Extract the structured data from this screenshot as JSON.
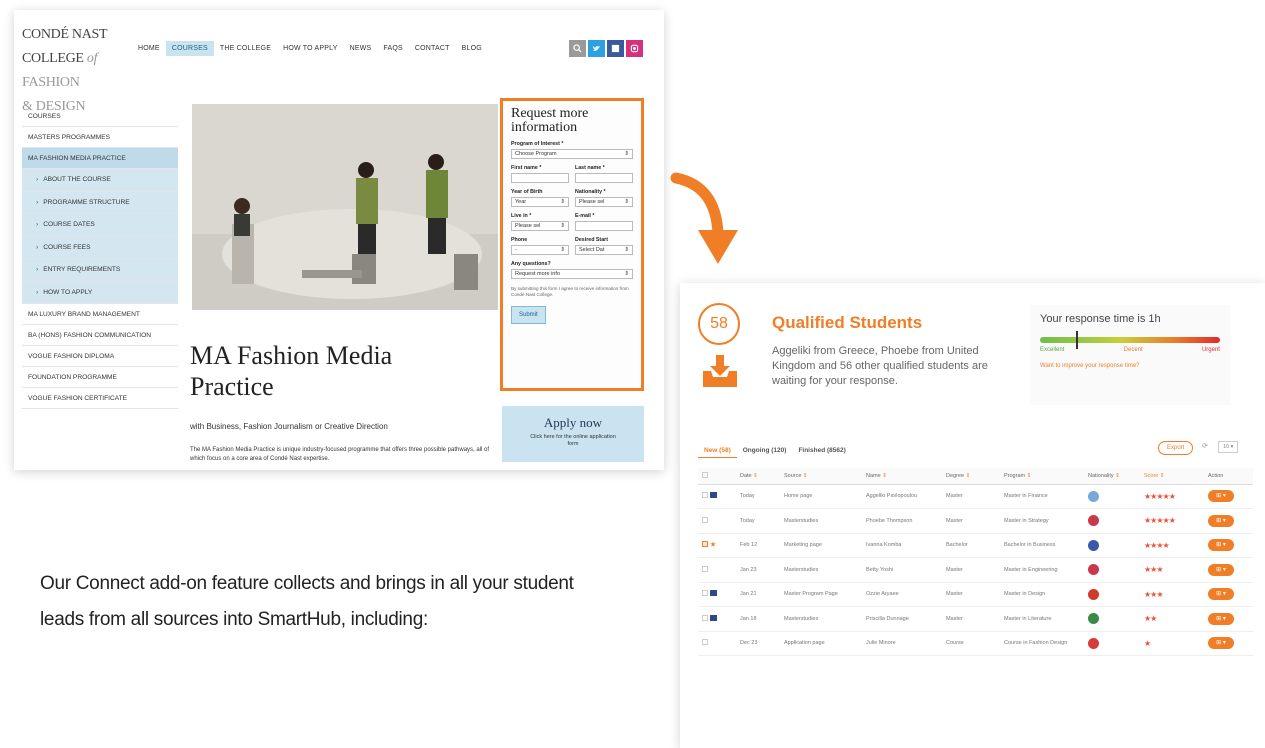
{
  "site": {
    "logo_line1": "CONDÉ NAST",
    "logo_line2": "COLLEGE",
    "logo_line2b": "of",
    "logo_line3": "FASHION",
    "logo_line4": "& DESIGN",
    "nav": [
      "HOME",
      "COURSES",
      "THE COLLEGE",
      "HOW TO APPLY",
      "NEWS",
      "FAQS",
      "CONTACT",
      "BLOG"
    ],
    "nav_active": "COURSES",
    "social_icons": [
      "search-icon",
      "twitter-icon",
      "facebook-icon",
      "instagram-icon"
    ],
    "sidebar": [
      {
        "label": "COURSES",
        "state": "normal"
      },
      {
        "label": "MASTERS PROGRAMMES",
        "state": "normal"
      },
      {
        "label": "MA FASHION MEDIA PRACTICE",
        "state": "active"
      },
      {
        "label": "ABOUT THE COURSE",
        "state": "sub"
      },
      {
        "label": "PROGRAMME STRUCTURE",
        "state": "sub"
      },
      {
        "label": "COURSE DATES",
        "state": "sub"
      },
      {
        "label": "COURSE FEES",
        "state": "sub"
      },
      {
        "label": "ENTRY REQUIREMENTS",
        "state": "sub"
      },
      {
        "label": "HOW TO APPLY",
        "state": "sub"
      },
      {
        "label": "MA LUXURY BRAND MANAGEMENT",
        "state": "normal"
      },
      {
        "label": "BA (HONS) FASHION COMMUNICATION",
        "state": "normal"
      },
      {
        "label": "VOGUE FASHION DIPLOMA",
        "state": "normal"
      },
      {
        "label": "FOUNDATION PROGRAMME",
        "state": "normal"
      },
      {
        "label": "VOGUE FASHION CERTIFICATE",
        "state": "normal"
      }
    ],
    "page_title_1": "MA Fashion Media",
    "page_title_2": "Practice",
    "page_subtitle": "with Business, Fashion Journalism or Creative Direction",
    "page_intro": "The MA Fashion Media Practice is unique industry-focused programme that offers three possible pathways, all of which focus on a core area of Condé Nast expertise.",
    "form": {
      "title": "Request more information",
      "program_label": "Program of Interest *",
      "program_value": "Choose Program",
      "first_name_label": "First name *",
      "last_name_label": "Last name *",
      "year_label": "Year of Birth",
      "year_value": "Year",
      "nationality_label": "Nationality *",
      "nationality_value": "Please sel",
      "live_label": "Live in *",
      "live_value": "Please sel",
      "email_label": "E-mail *",
      "phone_label": "Phone",
      "phone_value": "-",
      "start_label": "Desired Start",
      "start_value": "Select Dat",
      "questions_label": "Any questions?",
      "questions_value": "Request more info",
      "note": "By submitting this form I agree to receive information from Condé Nast College.",
      "submit": "Submit"
    },
    "apply_title": "Apply now",
    "apply_sub": "Click here for the online application form"
  },
  "caption": "Our Connect add-on feature collects and brings in all your student leads from all sources into SmartHub, including:",
  "hub": {
    "count": "58",
    "title": "Qualified Students",
    "desc": "Aggeliki from Greece, Phoebe from United Kingdom and 56 other qualified students are waiting for your response.",
    "resp_title": "Your response time is 1h",
    "resp_good": "Excellent",
    "resp_mid": "Decent",
    "resp_bad": "Urgent",
    "resp_link": "Want to improve your response time?",
    "resp_level": 0.2,
    "tabs": [
      "New (58)",
      "Ongoing (120)",
      "Finished (8562)"
    ],
    "export": "Export",
    "per_page": "10",
    "columns": [
      "Date",
      "Source",
      "Name",
      "Degree",
      "Program",
      "Nationality",
      "Score",
      "Action"
    ],
    "rows": [
      {
        "date": "Today",
        "source": "Home page",
        "name": "Aggeliki Pavlopoulou",
        "degree": "Master",
        "program": "Master in Finance",
        "flag": "#7aa9d8",
        "score": "★★★★★",
        "mark": "flag"
      },
      {
        "date": "Today",
        "source": "Masterstudies",
        "name": "Phoebe Thompson",
        "degree": "Master",
        "program": "Master in Strategy",
        "flag": "#c9394a",
        "score": "★★★★★",
        "mark": ""
      },
      {
        "date": "Feb 12",
        "source": "Marketing page",
        "name": "Ivanna Komba",
        "degree": "Bachelor",
        "program": "Bachelor in Business",
        "flag": "#3a5aa8",
        "score": "★★★★",
        "mark": "star"
      },
      {
        "date": "Jan 23",
        "source": "Masterstudies",
        "name": "Betty Yoshi",
        "degree": "Master",
        "program": "Master in Engineering",
        "flag": "#c9394a",
        "score": "★★★",
        "mark": ""
      },
      {
        "date": "Jan 21",
        "source": "Master Program Page",
        "name": "Ozzie Aryaee",
        "degree": "Master",
        "program": "Master in Design",
        "flag": "#d23a2a",
        "score": "★★★",
        "mark": "flag"
      },
      {
        "date": "Jan 18",
        "source": "Masterstudies",
        "name": "Priscilla Dunnage",
        "degree": "Master",
        "program": "Master in Literature",
        "flag": "#3a8a4a",
        "score": "★★",
        "mark": "flag"
      },
      {
        "date": "Dec 23",
        "source": "Application page",
        "name": "Julie Minore",
        "degree": "Course",
        "program": "Course in Fashion Design",
        "flag": "#d63a3a",
        "score": "★",
        "mark": ""
      }
    ],
    "action_label": "⊞ ▾"
  }
}
